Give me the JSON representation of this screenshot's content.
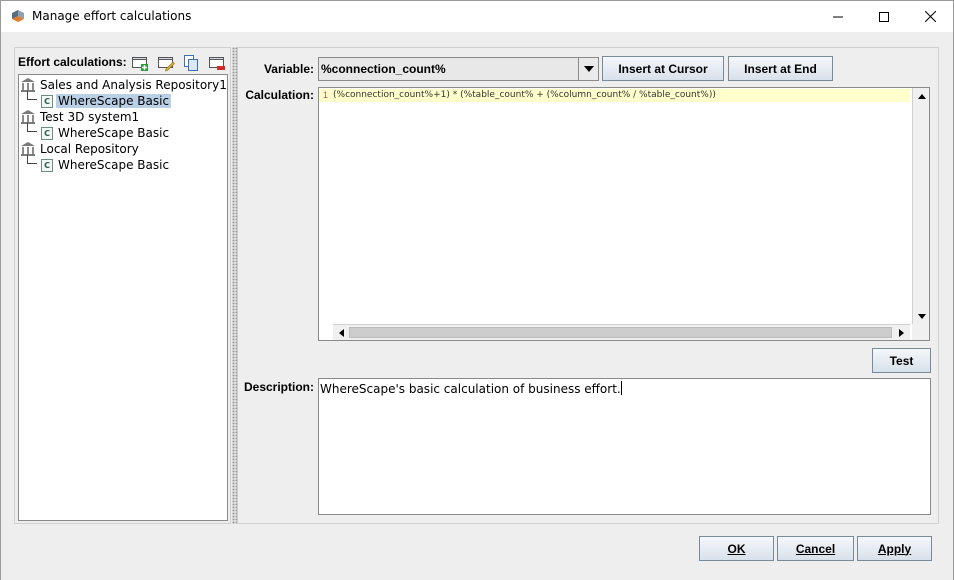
{
  "window": {
    "title": "Manage effort calculations",
    "controls": {
      "minimize": "minimize-icon",
      "maximize": "maximize-icon",
      "close": "close-icon"
    }
  },
  "left": {
    "title": "Effort calculations:",
    "toolbar": [
      "add-calculation-icon",
      "edit-calculation-icon",
      "copy-calculation-icon",
      "delete-calculation-icon"
    ],
    "tree": [
      {
        "label": "Sales and Analysis Repository1",
        "child": "WhereScape Basic",
        "child_selected": true
      },
      {
        "label": "Test 3D system1",
        "child": "WhereScape Basic",
        "child_selected": false
      },
      {
        "label": "Local Repository",
        "child": "WhereScape Basic",
        "child_selected": false
      }
    ]
  },
  "right": {
    "variable_label": "Variable:",
    "variable_value": "%connection_count%",
    "insert_cursor_label": "Insert at Cursor",
    "insert_end_label": "Insert at End",
    "calculation_label": "Calculation:",
    "calculation_line_number": "1",
    "calculation_code": "(%connection_count%+1) * (%table_count% + (%column_count% / %table_count%))",
    "test_label": "Test",
    "description_label": "Description:",
    "description_value": "WhereScape's basic calculation of business effort."
  },
  "footer": {
    "ok_label": "OK",
    "cancel_label": "Cancel",
    "apply_label": "Apply"
  }
}
